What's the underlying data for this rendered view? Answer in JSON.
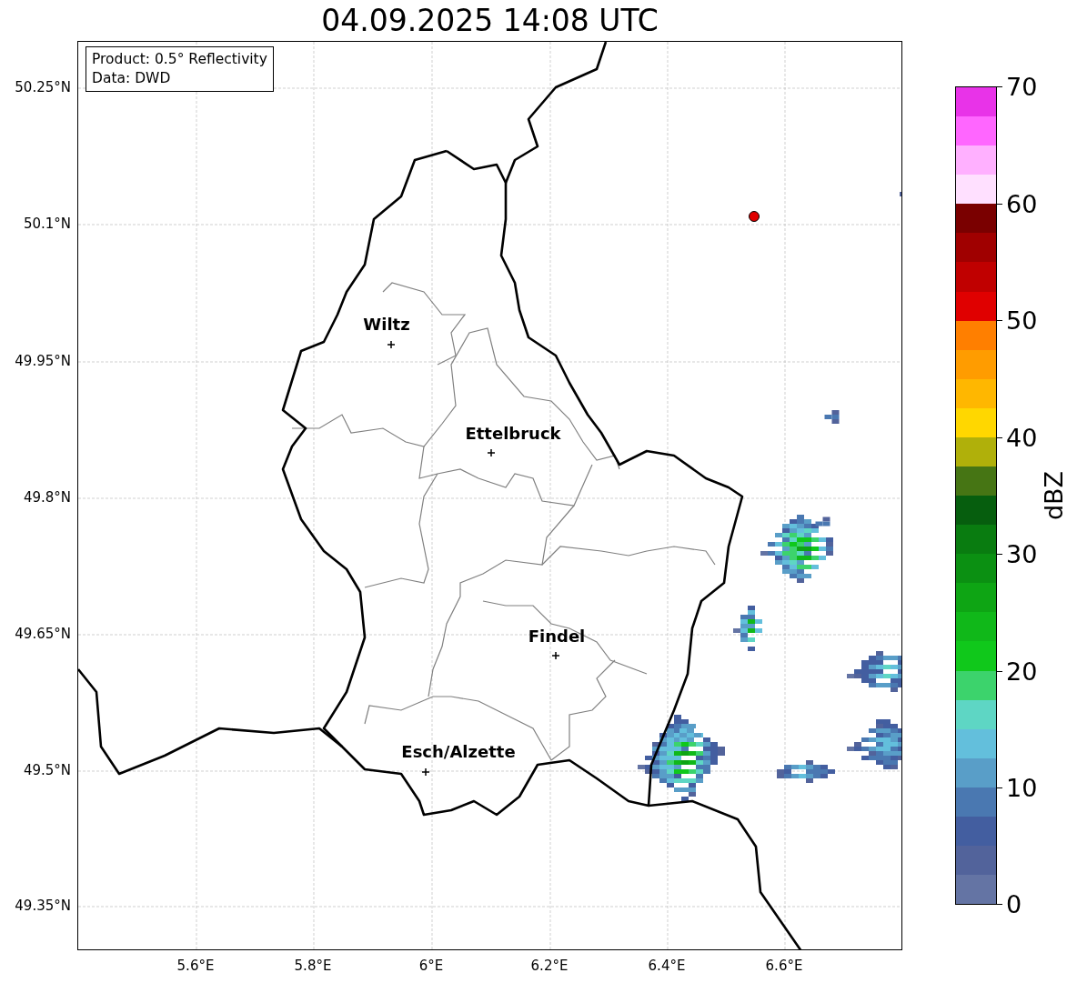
{
  "title": "04.09.2025 14:08 UTC",
  "info_box": {
    "lines": [
      "Product: 0.5° Reflectivity",
      "Data: DWD"
    ]
  },
  "y_ticks": [
    "50.25°N",
    "50.1°N",
    "49.95°N",
    "49.8°N",
    "49.65°N",
    "49.5°N",
    "49.35°N"
  ],
  "x_ticks": [
    "5.6°E",
    "5.8°E",
    "6°E",
    "6.2°E",
    "6.4°E",
    "6.6°E"
  ],
  "cities": [
    {
      "name": "Wiltz"
    },
    {
      "name": "Ettelbruck"
    },
    {
      "name": "Findel"
    },
    {
      "name": "Esch/Alzette"
    }
  ],
  "colorbar": {
    "label": "dBZ",
    "ticks": [
      "70",
      "60",
      "50",
      "40",
      "30",
      "20",
      "10",
      "0"
    ],
    "bins": [
      {
        "color": "#e833e8"
      },
      {
        "color": "#ff66ff"
      },
      {
        "color": "#ffb0ff"
      },
      {
        "color": "#ffe0ff"
      },
      {
        "color": "#7a0000"
      },
      {
        "color": "#a00000"
      },
      {
        "color": "#c00000"
      },
      {
        "color": "#e00000"
      },
      {
        "color": "#ff7f00"
      },
      {
        "color": "#ff9c00"
      },
      {
        "color": "#ffb700"
      },
      {
        "color": "#ffd700"
      },
      {
        "color": "#b0b00a"
      },
      {
        "color": "#467514"
      },
      {
        "color": "#065e0e"
      },
      {
        "color": "#097c10"
      },
      {
        "color": "#0b9012"
      },
      {
        "color": "#0ea514"
      },
      {
        "color": "#10b819"
      },
      {
        "color": "#10c81b"
      },
      {
        "color": "#3cd36c"
      },
      {
        "color": "#5ed6c4"
      },
      {
        "color": "#63bfdc"
      },
      {
        "color": "#599ec8"
      },
      {
        "color": "#4a78b1"
      },
      {
        "color": "#435ea0"
      },
      {
        "color": "#52639b"
      },
      {
        "color": "#6474a4"
      }
    ]
  }
}
